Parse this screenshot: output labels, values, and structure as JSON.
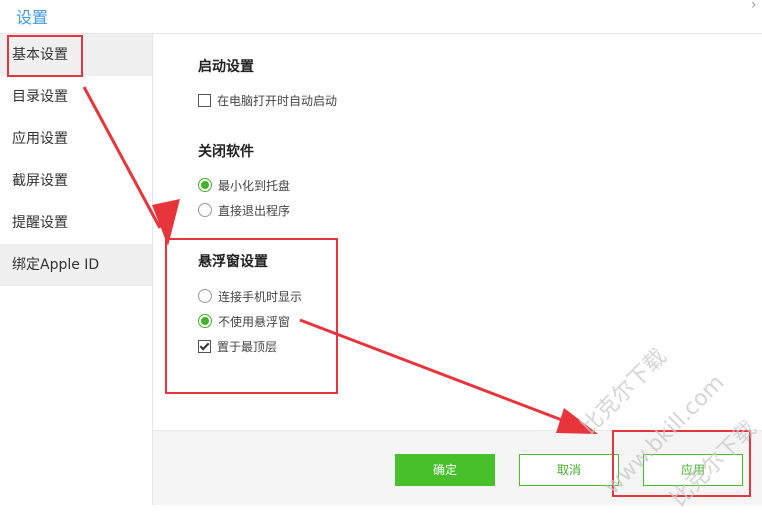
{
  "window": {
    "title": "设置",
    "close_glyph": "›"
  },
  "sidebar": {
    "items": [
      {
        "label": "基本设置"
      },
      {
        "label": "目录设置"
      },
      {
        "label": "应用设置"
      },
      {
        "label": "截屏设置"
      },
      {
        "label": "提醒设置"
      },
      {
        "label": "绑定Apple ID"
      }
    ]
  },
  "startup": {
    "title": "启动设置",
    "auto_start": {
      "label": "在电脑打开时自动启动",
      "checked": false
    }
  },
  "close_software": {
    "title": "关闭软件",
    "options": [
      {
        "label": "最小化到托盘",
        "selected": true
      },
      {
        "label": "直接退出程序",
        "selected": false
      }
    ]
  },
  "floating_window": {
    "title": "悬浮窗设置",
    "options": [
      {
        "label": "连接手机时显示",
        "selected": false
      },
      {
        "label": "不使用悬浮窗",
        "selected": true
      }
    ],
    "always_on_top": {
      "label": "置于最顶层",
      "checked": true
    }
  },
  "buttons": {
    "ok": "确定",
    "cancel": "取消",
    "apply": "应用"
  },
  "watermark": {
    "line1": "比克尔下载",
    "line2": "www.bkill.com",
    "line3": "比克尔下载"
  },
  "colors": {
    "accent": "#3d9be9",
    "green": "#48c02c",
    "annotation": "#e8343b"
  }
}
